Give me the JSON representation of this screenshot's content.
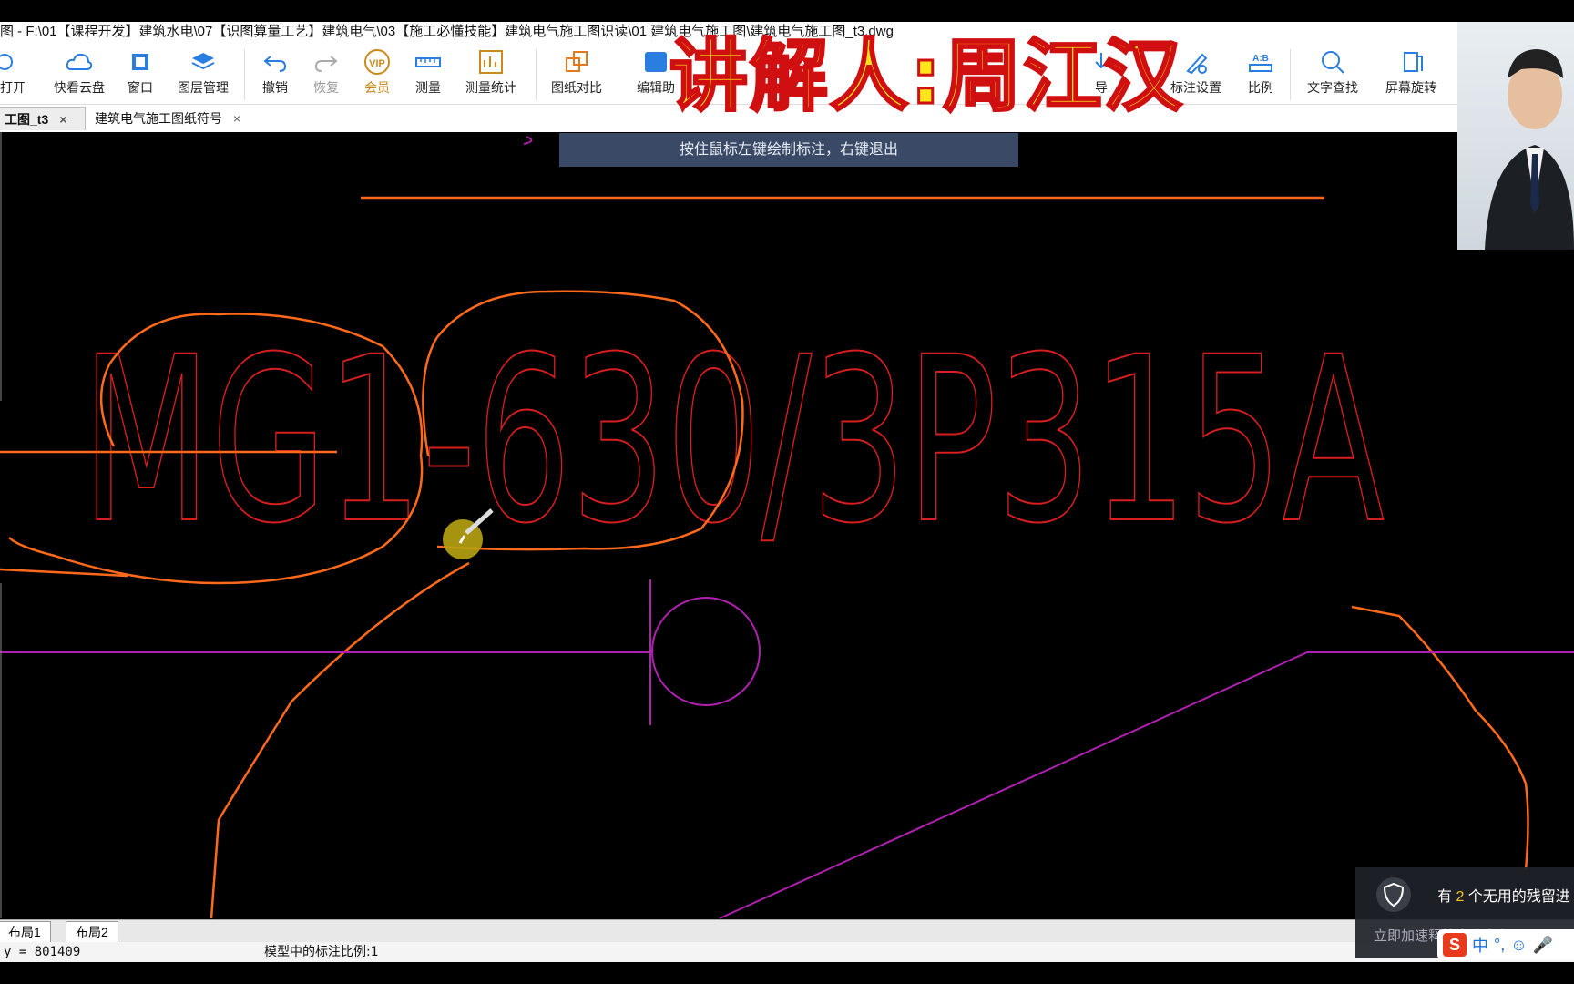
{
  "title": "图 - F:\\01【课程开发】建筑水电\\07【识图算量工艺】建筑电气\\03【施工必懂技能】建筑电气施工图识读\\01  建筑电气施工图\\建筑电气施工图_t3.dwg",
  "toolbar": {
    "open": "打开",
    "cloud": "快看云盘",
    "window": "窗口",
    "layers": "图层管理",
    "undo": "撤销",
    "redo": "恢复",
    "vip_badge": "VIP",
    "vip": "会员",
    "measure": "测量",
    "measure_stats": "测量统计",
    "compare": "图纸对比",
    "edit_assist": "编辑助",
    "import": "导",
    "annotate_settings": "标注设置",
    "scale": "比例",
    "ab_badge": "A:B",
    "text_search": "文字查找",
    "rotate_screen": "屏幕旋转"
  },
  "tabs": [
    {
      "label": "工图_t3",
      "close": "×"
    },
    {
      "label": "建筑电气施工图纸符号",
      "close": "×"
    }
  ],
  "hint": "按住鼠标左键绘制标注，右键退出",
  "banner": "讲解人:周江汉",
  "drawing": {
    "label": "MG1-630/3P315A"
  },
  "layout_tabs": [
    "布局1",
    "布局2"
  ],
  "status": {
    "coord": "y = 801409",
    "scale_text": "模型中的标注比例:1"
  },
  "popup": {
    "line1_prefix": "有 ",
    "count": "2",
    "line1_suffix": " 个无用的残留进",
    "line2": "立即加速释放电脑内存"
  },
  "ime": {
    "mode": "中",
    "punct": "°,"
  },
  "colors": {
    "annotation": "#ff6a1a",
    "text": "#d81e1e",
    "magenta": "#b020b0",
    "hint_bg": "#3a4a66"
  }
}
